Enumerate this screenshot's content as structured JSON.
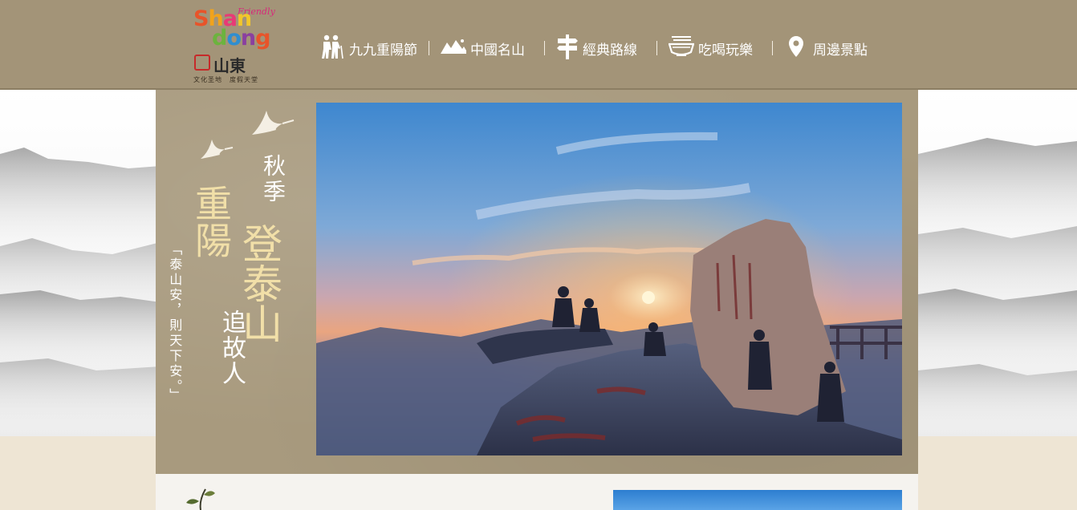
{
  "logo": {
    "friendly": "Friendly",
    "word_shan": "Shan",
    "word_dong": "dong",
    "cn": "山東",
    "tagline": "文化圣地　度假天堂"
  },
  "nav": [
    {
      "label": "九九重陽節",
      "icon": "elderly-couple-icon"
    },
    {
      "label": "中國名山",
      "icon": "mountain-icon"
    },
    {
      "label": "經典路線",
      "icon": "signpost-icon"
    },
    {
      "label": "吃喝玩樂",
      "icon": "noodle-bowl-icon"
    },
    {
      "label": "周邊景點",
      "icon": "map-pin-icon"
    }
  ],
  "hero": {
    "autumn": "秋季",
    "chongyang": "重陽",
    "deng_taishan": "登泰山",
    "zhui_guren": "追故人",
    "quote": "「泰山安，則天下安。」"
  },
  "colors": {
    "header_bg": "#a39478",
    "panel_bg": "#a89a7e",
    "gold_text": "#f1dfa8",
    "nav_text": "#ffffff"
  }
}
